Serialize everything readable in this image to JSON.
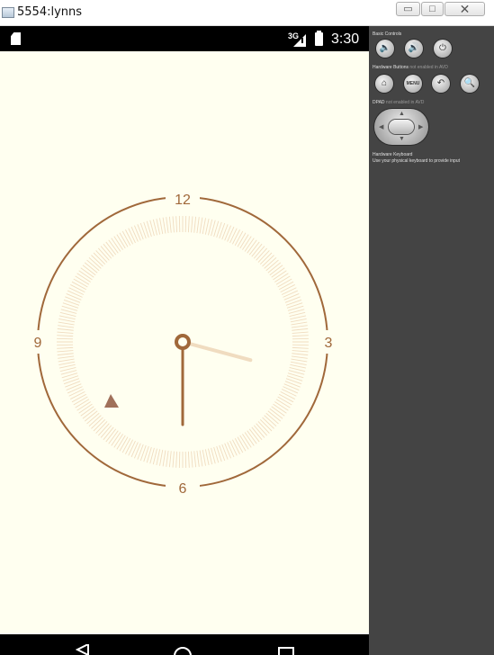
{
  "window": {
    "title": "5554:lynns",
    "minimize_glyph": "▭",
    "maximize_glyph": "□",
    "close_glyph": "✕"
  },
  "statusbar": {
    "network": "3G",
    "time": "3:30",
    "icons": [
      "sd-card-icon",
      "signal-icon",
      "battery-icon"
    ]
  },
  "clock": {
    "numerals": {
      "top": "12",
      "right": "3",
      "bottom": "6",
      "left": "9"
    },
    "time": {
      "hour": 3,
      "minute": 30
    },
    "colors": {
      "accent": "#a0683a",
      "light_accent": "#f0dcc0",
      "background": "#fffff0",
      "marker": "#a0705a"
    }
  },
  "navbar": {
    "icons": [
      "back-icon",
      "home-icon",
      "recents-icon"
    ]
  },
  "panel": {
    "basic_controls_label": "Basic Controls",
    "hardware_buttons_label": "Hardware Buttons",
    "hardware_buttons_note": "not enabled in AVD",
    "dpad_label": "DPAD",
    "dpad_note": "not enabled in AVD",
    "keyboard_label": "Hardware Keyboard",
    "keyboard_note": "Use your physical keyboard to provide input",
    "menu_label": "MENU",
    "basic_buttons": [
      "volume-down-icon",
      "volume-up-icon",
      "power-icon"
    ],
    "hardware_buttons": [
      "home-icon",
      "menu-button",
      "back-icon",
      "search-icon"
    ]
  }
}
